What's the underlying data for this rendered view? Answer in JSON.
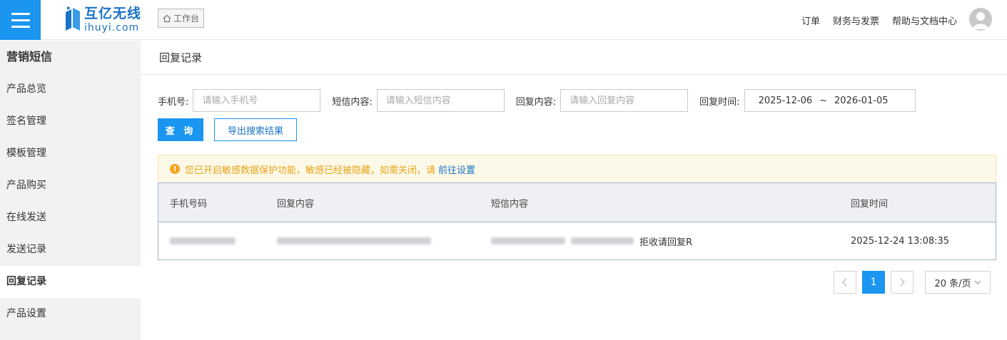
{
  "header": {
    "logo_cn": "互亿无线",
    "logo_en": "ihuyi.com",
    "workbench_label": "工作台",
    "links": [
      "订单",
      "财务与发票",
      "帮助与文档中心"
    ],
    "brand_color": "#1a95f0"
  },
  "sidebar": {
    "title": "营销短信",
    "items": [
      {
        "label": "产品总览",
        "active": false
      },
      {
        "label": "签名管理",
        "active": false
      },
      {
        "label": "模板管理",
        "active": false
      },
      {
        "label": "产品购买",
        "active": false
      },
      {
        "label": "在线发送",
        "active": false
      },
      {
        "label": "发送记录",
        "active": false
      },
      {
        "label": "回复记录",
        "active": true
      },
      {
        "label": "产品设置",
        "active": false
      }
    ]
  },
  "page": {
    "title": "回复记录"
  },
  "filters": {
    "phone_label": "手机号:",
    "phone_placeholder": "请输入手机号",
    "sms_label": "短信内容:",
    "sms_placeholder": "请输入短信内容",
    "reply_label": "回复内容:",
    "reply_placeholder": "请输入回复内容",
    "time_label": "回复时间:",
    "date_start": "2025-12-06",
    "date_sep": "~",
    "date_end": "2026-01-05",
    "query_label": "查 询",
    "export_label": "导出搜索结果"
  },
  "notice": {
    "text": "您已开启敏感数据保护功能，敏感已经被隐藏，如需关闭，请",
    "link": "前往设置"
  },
  "table": {
    "columns": [
      "手机号码",
      "回复内容",
      "短信内容",
      "回复时间"
    ],
    "rows": [
      {
        "sms_suffix": "拒收请回复R",
        "time": "2025-12-24 13:08:35"
      }
    ]
  },
  "pagination": {
    "current": "1",
    "page_size": "20 条/页"
  }
}
